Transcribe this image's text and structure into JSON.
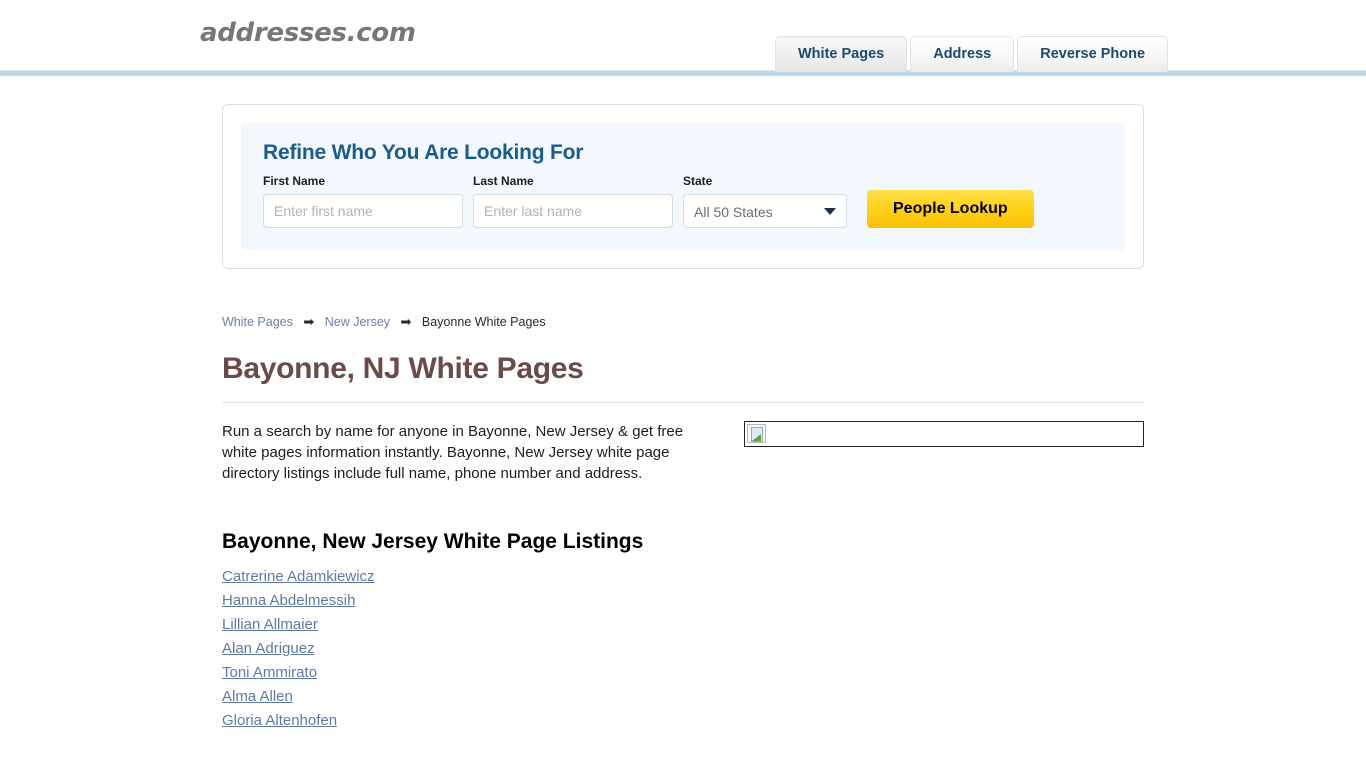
{
  "header": {
    "logo": "addresses.com",
    "tabs": [
      {
        "label": "White Pages",
        "active": true
      },
      {
        "label": "Address",
        "active": false
      },
      {
        "label": "Reverse Phone",
        "active": false
      }
    ]
  },
  "search_panel": {
    "title": "Refine Who You Are Looking For",
    "first_name": {
      "label": "First Name",
      "placeholder": "Enter first name",
      "value": ""
    },
    "last_name": {
      "label": "Last Name",
      "placeholder": "Enter last name",
      "value": ""
    },
    "state": {
      "label": "State",
      "selected": "All 50 States"
    },
    "submit_label": "People Lookup"
  },
  "breadcrumb": {
    "items": [
      {
        "label": "White Pages",
        "link": true
      },
      {
        "label": "New Jersey",
        "link": true
      },
      {
        "label": "Bayonne White Pages",
        "link": false
      }
    ],
    "separator": "➡"
  },
  "main": {
    "page_title": "Bayonne, NJ White Pages",
    "intro": "Run a search by name for anyone in Bayonne, New Jersey & get free white pages information instantly. Bayonne, New Jersey white page directory listings include full name, phone number and address.",
    "listings_title": "Bayonne, New Jersey White Page Listings",
    "listings": [
      "Catrerine Adamkiewicz",
      "Hanna Abdelmessih",
      "Lillian Allmaier",
      "Alan Adriguez",
      "Toni Ammirato",
      "Alma Allen",
      "Gloria Altenhofen"
    ]
  },
  "colors": {
    "tab_text": "#1b4a72",
    "header_rule": "#bdd8ea",
    "panel_bg": "#f2f8fd",
    "refine_title": "#1b5c8c",
    "page_title": "#6b4a4a",
    "link": "#5e7aa8",
    "button_gold": "#ffd21a"
  }
}
